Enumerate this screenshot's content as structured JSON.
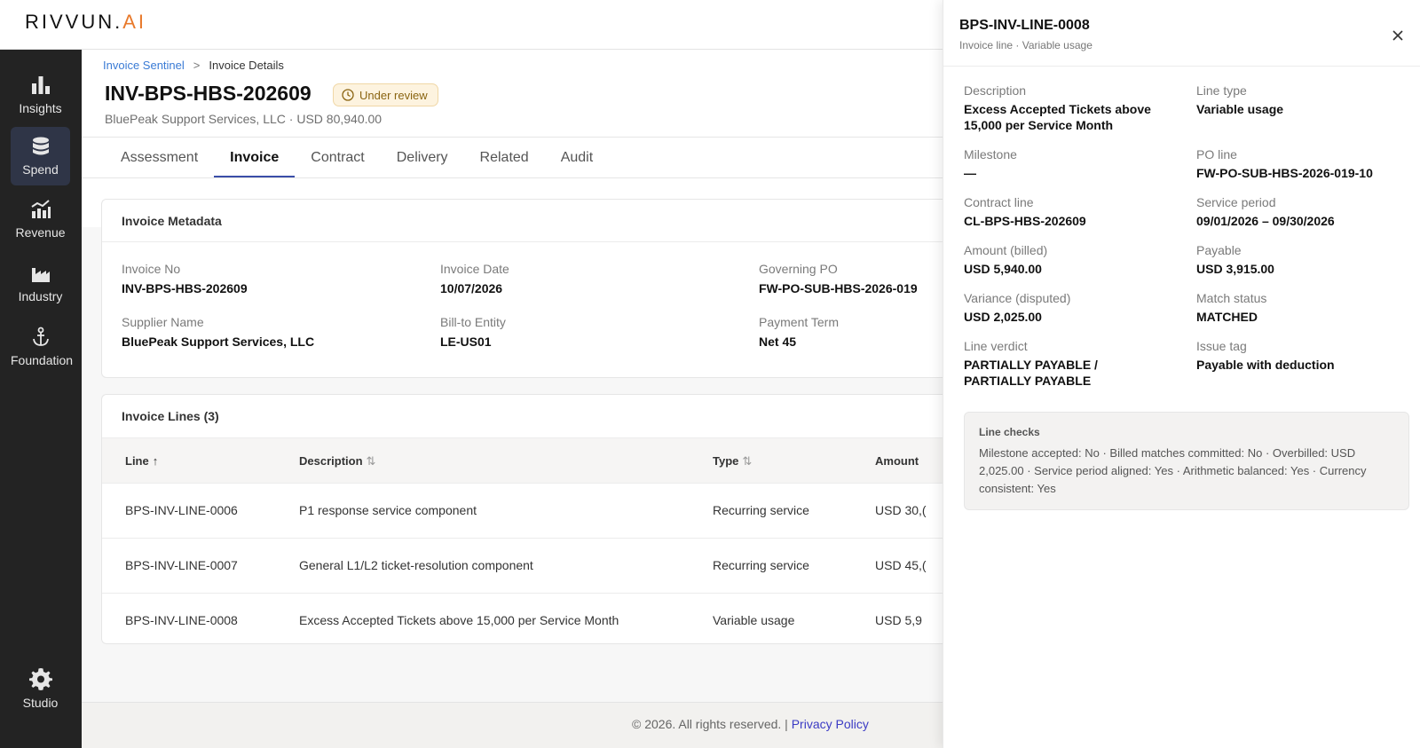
{
  "app": {
    "logo_main": "RIVVUN.",
    "logo_ai": "AI"
  },
  "sidebar": {
    "items": [
      {
        "label": "Insights",
        "icon": "bar-chart-icon"
      },
      {
        "label": "Spend",
        "icon": "database-icon"
      },
      {
        "label": "Revenue",
        "icon": "revenue-chart-icon"
      },
      {
        "label": "Industry",
        "icon": "factory-icon"
      },
      {
        "label": "Foundation",
        "icon": "anchor-icon"
      },
      {
        "label": "Studio",
        "icon": "gear-icon"
      }
    ],
    "active": "Spend"
  },
  "breadcrumb": {
    "parent": "Invoice Sentinel",
    "separator": ">",
    "current": "Invoice Details"
  },
  "header": {
    "invoice_id": "INV-BPS-HBS-202609",
    "status": "Under review",
    "status_colors": {
      "bg": "#fdf3df",
      "border": "#f0d7a6",
      "text": "#8a6411"
    },
    "subtitle": "BluePeak Support Services, LLC · USD 80,940.00"
  },
  "tabs": [
    {
      "label": "Assessment"
    },
    {
      "label": "Invoice"
    },
    {
      "label": "Contract"
    },
    {
      "label": "Delivery"
    },
    {
      "label": "Related"
    },
    {
      "label": "Audit"
    }
  ],
  "active_tab": "Invoice",
  "metadata": {
    "title": "Invoice Metadata",
    "fields": [
      {
        "label": "Invoice No",
        "value": "INV-BPS-HBS-202609"
      },
      {
        "label": "Invoice Date",
        "value": "10/07/2026"
      },
      {
        "label": "Governing PO",
        "value": "FW-PO-SUB-HBS-2026-019"
      },
      {
        "label": "Supplier Name",
        "value": "BluePeak Support Services, LLC"
      },
      {
        "label": "Bill-to Entity",
        "value": "LE-US01"
      },
      {
        "label": "Payment Term",
        "value": "Net 45"
      }
    ]
  },
  "lines": {
    "title": "Invoice Lines (3)",
    "columns": [
      {
        "label": "Line",
        "sort": "↑"
      },
      {
        "label": "Description",
        "sort": "⇅"
      },
      {
        "label": "Type",
        "sort": "⇅"
      },
      {
        "label": "Amount",
        "sort": ""
      }
    ],
    "rows": [
      {
        "line": "BPS-INV-LINE-0006",
        "description": "P1 response service component",
        "type": "Recurring service",
        "amount": "USD 30,("
      },
      {
        "line": "BPS-INV-LINE-0007",
        "description": "General L1/L2 ticket-resolution component",
        "type": "Recurring service",
        "amount": "USD 45,("
      },
      {
        "line": "BPS-INV-LINE-0008",
        "description": "Excess Accepted Tickets above 15,000 per Service Month",
        "type": "Variable usage",
        "amount": "USD 5,9"
      }
    ]
  },
  "footer": {
    "copyright": "© 2026. All rights reserved. |",
    "privacy": "Privacy Policy"
  },
  "drawer": {
    "title": "BPS-INV-LINE-0008",
    "subtitle": "Invoice line · Variable usage",
    "fields": [
      {
        "label": "Description",
        "value": "Excess Accepted Tickets above 15,000 per Service Month"
      },
      {
        "label": "Line type",
        "value": "Variable usage"
      },
      {
        "label": "Milestone",
        "value": "—"
      },
      {
        "label": "PO line",
        "value": "FW-PO-SUB-HBS-2026-019-10"
      },
      {
        "label": "Contract line",
        "value": "CL-BPS-HBS-202609"
      },
      {
        "label": "Service period",
        "value": "09/01/2026 – 09/30/2026"
      },
      {
        "label": "Amount (billed)",
        "value": "USD 5,940.00"
      },
      {
        "label": "Payable",
        "value": "USD 3,915.00"
      },
      {
        "label": "Variance (disputed)",
        "value": "USD 2,025.00"
      },
      {
        "label": "Match status",
        "value": "MATCHED"
      },
      {
        "label": "Line verdict",
        "value": "PARTIALLY PAYABLE / PARTIALLY PAYABLE"
      },
      {
        "label": "Issue tag",
        "value": "Payable with deduction"
      }
    ],
    "checks": {
      "title": "Line checks",
      "body": "Milestone accepted: No · Billed matches committed: No · Overbilled: USD 2,025.00 · Service period aligned: Yes · Arithmetic balanced: Yes · Currency consistent: Yes"
    }
  }
}
